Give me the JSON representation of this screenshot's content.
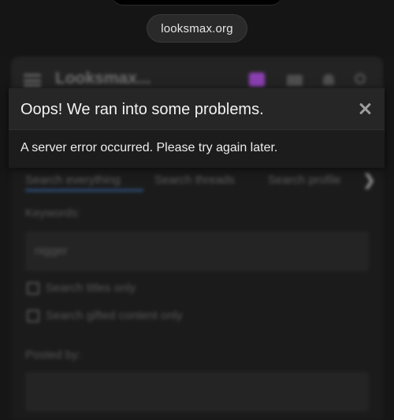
{
  "browser": {
    "url": "looksmax.org"
  },
  "site": {
    "logo": "Looksmax...",
    "tabs": [
      "Search everything",
      "Search threads",
      "Search profile"
    ],
    "tab_more_icon": "chevron-right-icon",
    "keywords_label": "Keywords:",
    "keywords_value": "nigger",
    "checkbox_1": "Search titles only",
    "checkbox_2": "Search gifted content only",
    "posted_by_label": "Posted by:",
    "accent_color": "#8a3fb0",
    "tab_underline_color": "#2d4e7c"
  },
  "dialog": {
    "title": "Oops! We ran into some problems.",
    "message": "A server error occurred. Please try again later.",
    "close_icon": "close-icon"
  }
}
